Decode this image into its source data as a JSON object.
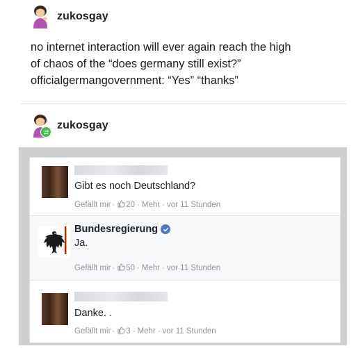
{
  "post1": {
    "username": "zukosgay",
    "lines": [
      "no internet interaction will ever again reach the high",
      "of chaos of the “does germany still exist?”",
      "officialgermangovernment: “Yes” “thanks”"
    ]
  },
  "post2": {
    "username": "zukosgay"
  },
  "facebook": {
    "comments": [
      {
        "text": "Gibt es noch Deutschland?",
        "like_label": "Gefällt mir",
        "likes": "20",
        "more_label": "Mehr",
        "time": "vor 11 Stunden"
      },
      {
        "author": "Bundesregierung",
        "text": "Ja.",
        "like_label": "Gefällt mir",
        "likes": "50",
        "more_label": "Mehr",
        "time": "vor 11 Stunden"
      },
      {
        "text": "Danke. .",
        "like_label": "Gefällt mir",
        "likes": "3",
        "more_label": "Mehr",
        "time": "vor 11 Stunden"
      }
    ],
    "separator": "·"
  },
  "colors": {
    "verified": "#4e78c9",
    "reblog": "#3fbf4a",
    "meta_text": "#90949c",
    "frame": "#cfcfcf"
  }
}
